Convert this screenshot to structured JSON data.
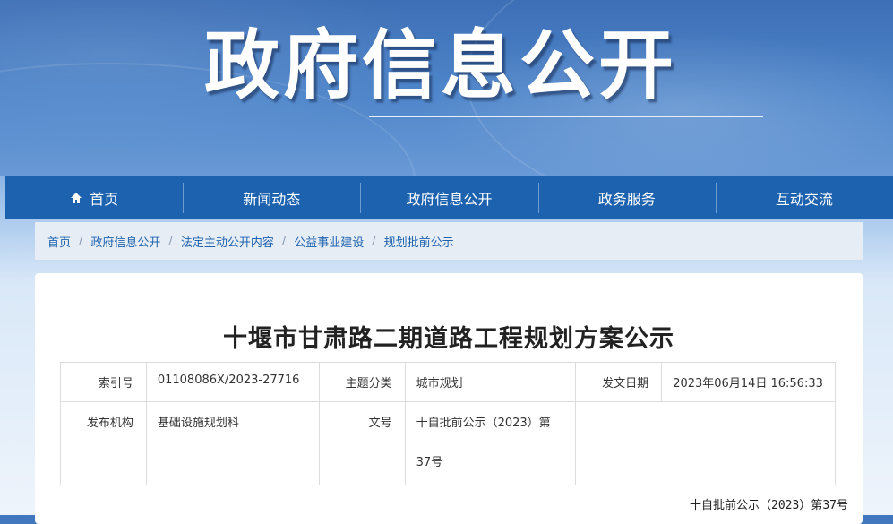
{
  "banner": {
    "title": "政府信息公开"
  },
  "nav": {
    "items": [
      {
        "label": "首页",
        "icon": "home-icon"
      },
      {
        "label": "新闻动态"
      },
      {
        "label": "政府信息公开"
      },
      {
        "label": "政务服务"
      },
      {
        "label": "互动交流"
      }
    ]
  },
  "breadcrumb": [
    "首页",
    "政府信息公开",
    "法定主动公开内容",
    "公益事业建设",
    "规划批前公示"
  ],
  "article": {
    "title": "十堰市甘肃路二期道路工程规划方案公示",
    "meta": {
      "index_label": "索引号",
      "index_value": "01108086X/2023-27716",
      "topic_label": "主题分类",
      "topic_value": "城市规划",
      "date_label": "发文日期",
      "date_value": "2023年06月14日 16:56:33",
      "org_label": "发布机构",
      "org_value": "基础设施规划科",
      "docno_label": "文号",
      "docno_value": "十自批前公示（2023）第37号"
    },
    "doc_number_line": "十自批前公示（2023）第37号"
  },
  "colors": {
    "nav_bg": "#1d62ae",
    "link": "#1d62ae"
  }
}
